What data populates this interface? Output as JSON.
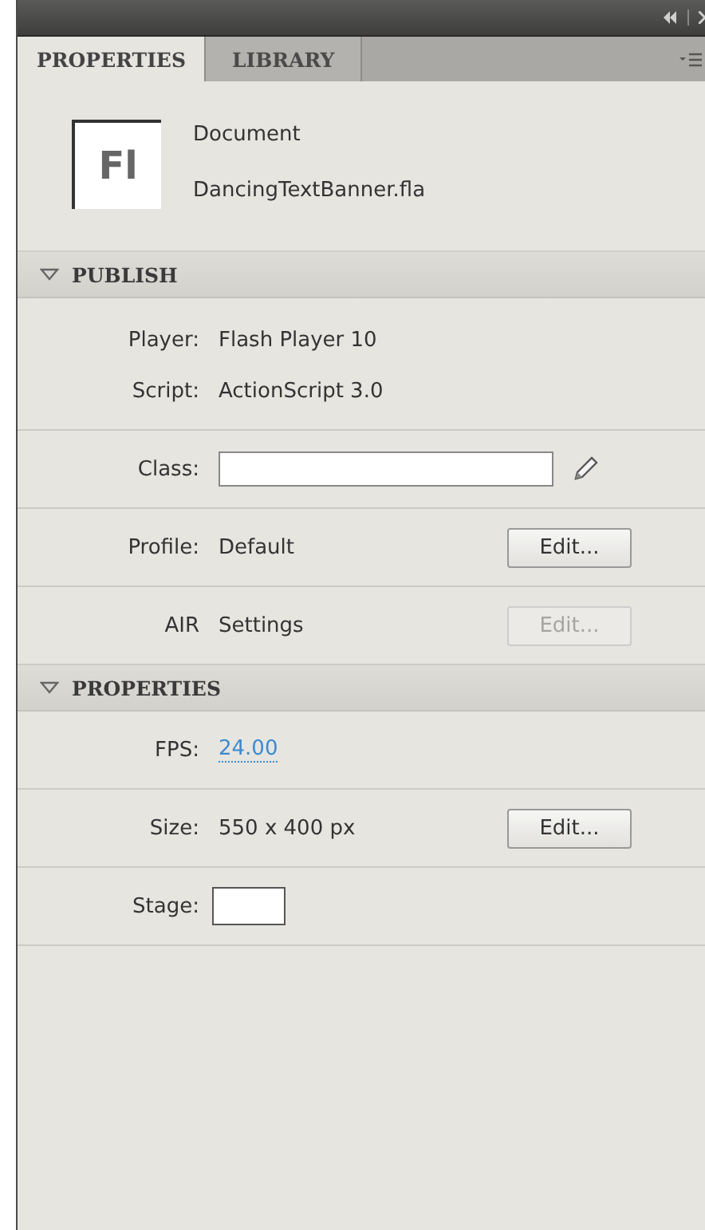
{
  "tabs": [
    {
      "label": "PROPERTIES",
      "selected": true
    },
    {
      "label": "LIBRARY",
      "selected": false
    }
  ],
  "document": {
    "icon_text": "Fl",
    "type": "Document",
    "file": "DancingTextBanner.fla"
  },
  "sections": [
    {
      "title": "PUBLISH",
      "expanded": true,
      "groups": [
        [
          {
            "kind": "info",
            "label": "Player:",
            "value": "Flash Player 10"
          },
          {
            "kind": "info",
            "label": "Script:",
            "value": "ActionScript 3.0"
          }
        ],
        [
          {
            "kind": "field",
            "label": "Class:"
          }
        ],
        [
          {
            "kind": "button",
            "label": "Profile:",
            "value": "Default",
            "button": "Edit...",
            "disabled": false
          }
        ],
        [
          {
            "kind": "button",
            "label": "AIR",
            "value": "Settings",
            "button": "Edit...",
            "disabled": true
          }
        ]
      ]
    },
    {
      "title": "PROPERTIES",
      "expanded": true,
      "groups": [
        [
          {
            "kind": "link",
            "label": "FPS:",
            "value": "24.00"
          }
        ],
        [
          {
            "kind": "button",
            "label": "Size:",
            "value": "550 x 400 px",
            "button": "Edit...",
            "disabled": false
          }
        ],
        [
          {
            "kind": "swatch",
            "label": "Stage:"
          }
        ]
      ]
    }
  ]
}
